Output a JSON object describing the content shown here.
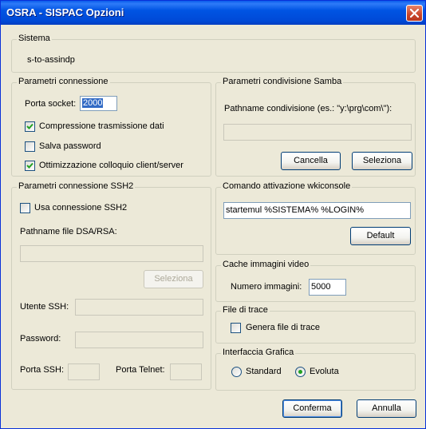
{
  "window": {
    "title": "OSRA - SISPAC Opzioni"
  },
  "sistema": {
    "legend": "Sistema",
    "value": "s-to-assindp"
  },
  "connessione": {
    "legend": "Parametri connessione",
    "porta_label": "Porta socket:",
    "porta_value": "2000",
    "compressione_label": "Compressione trasmissione dati",
    "compressione_checked": true,
    "salva_password_label": "Salva password",
    "salva_password_checked": false,
    "ottimizzazione_label": "Ottimizzazione colloquio client/server",
    "ottimizzazione_checked": true
  },
  "samba": {
    "legend": "Parametri condivisione Samba",
    "pathname_label": "Pathname condivisione (es.: \"y:\\prg\\com\\\"):",
    "pathname_value": "",
    "cancella_label": "Cancella",
    "seleziona_label": "Seleziona"
  },
  "ssh2": {
    "legend": "Parametri connessione SSH2",
    "usa_label": "Usa connessione SSH2",
    "usa_checked": false,
    "dsa_label": "Pathname file DSA/RSA:",
    "dsa_value": "",
    "seleziona_label": "Seleziona",
    "utente_label": "Utente SSH:",
    "utente_value": "",
    "password_label": "Password:",
    "password_value": "",
    "porta_ssh_label": "Porta SSH:",
    "porta_ssh_value": "",
    "porta_telnet_label": "Porta Telnet:",
    "porta_telnet_value": ""
  },
  "wkiconsole": {
    "legend": "Comando attivazione wkiconsole",
    "command_value": "startemul %SISTEMA% %LOGIN%",
    "default_label": "Default"
  },
  "cache": {
    "legend": "Cache immagini video",
    "numero_label": "Numero immagini:",
    "numero_value": "5000"
  },
  "trace": {
    "legend": "File di trace",
    "genera_label": "Genera file di trace",
    "genera_checked": false
  },
  "interfaccia": {
    "legend": "Interfaccia Grafica",
    "standard_label": "Standard",
    "evoluta_label": "Evoluta",
    "selected": "Evoluta"
  },
  "footer": {
    "conferma_label": "Conferma",
    "annulla_label": "Annulla"
  }
}
